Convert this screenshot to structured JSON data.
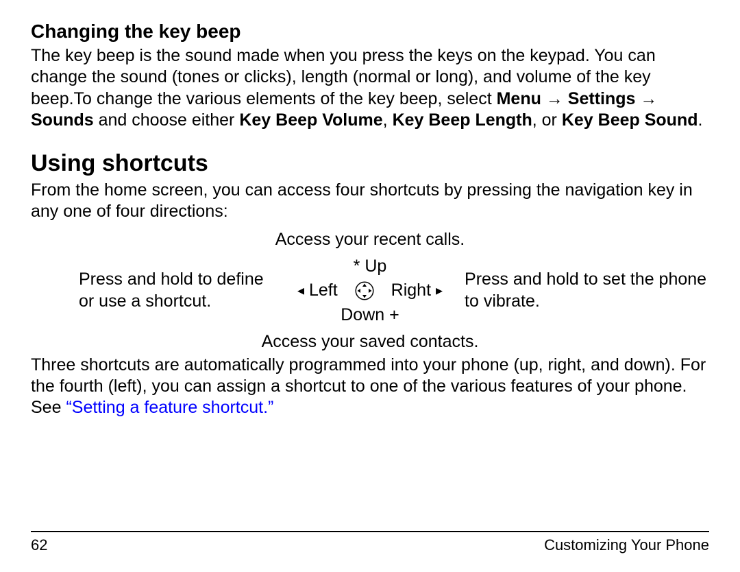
{
  "section1": {
    "heading": "Changing the key beep",
    "para_pre": "The key beep is the sound made when you press the keys on the keypad. You can change the sound (tones or clicks), length (normal or long), and volume of the key beep.To change the various elements of the key beep, select ",
    "path1": "Menu",
    "arrow": " → ",
    "path2": "Settings",
    "path3": "Sounds",
    "mid": " and choose either ",
    "opt1": "Key Beep Volume",
    "sep1": ", ",
    "opt2": "Key Beep Length",
    "sep2": ", or ",
    "opt3": "Key Beep Sound",
    "end": "."
  },
  "section2": {
    "heading": "Using shortcuts",
    "intro": "From the home screen, you can access four shortcuts by pressing the navigation key in any one of four directions:",
    "top_cap": "Access your recent calls.",
    "left_text": "Press and hold to define or use a shortcut.",
    "right_text": "Press and hold to set the phone to vibrate.",
    "up": "Up",
    "down": "Down",
    "left": "Left",
    "right": "Right",
    "bottom_cap": "Access your saved contacts.",
    "para2_pre": "Three shortcuts are automatically programmed into your phone (up, right, and down). For the fourth (left), you can assign a shortcut to one of the various features of your phone. See ",
    "link": "“Setting a feature shortcut.”"
  },
  "footer": {
    "page": "62",
    "title": "Customizing Your Phone"
  }
}
